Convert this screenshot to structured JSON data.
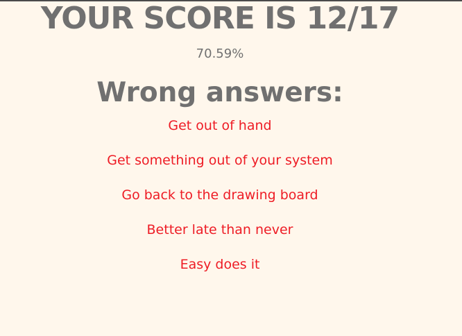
{
  "result": {
    "score_text": "YOUR SCORE IS 12/17",
    "percent_text": "70.59%",
    "wrong_heading": "Wrong answers:",
    "wrong_answers": [
      "Get out of hand",
      "Get something out of your system",
      "Go back to the drawing board",
      "Better late than never",
      "Easy does it"
    ]
  },
  "colors": {
    "background": "#fff7ec",
    "heading_gray": "#707070",
    "wrong_red": "#ee1c25"
  }
}
